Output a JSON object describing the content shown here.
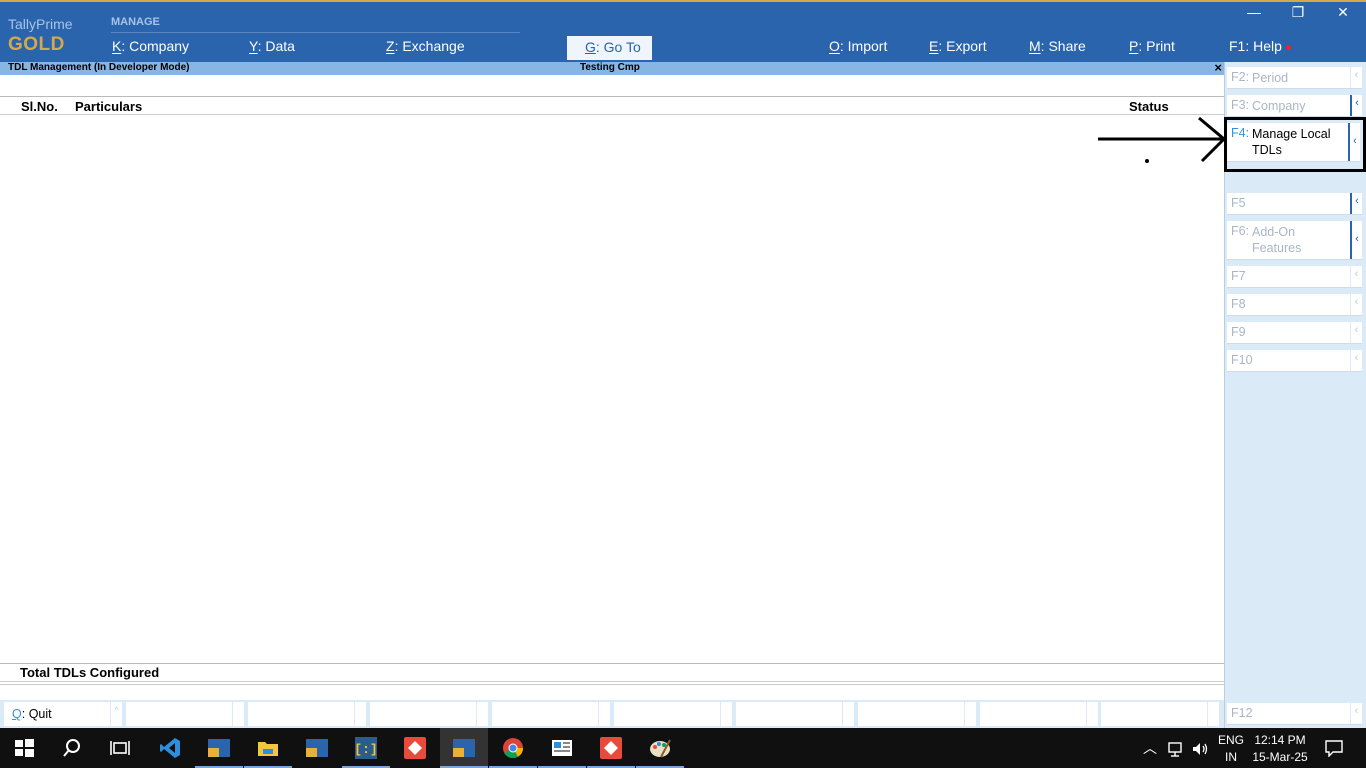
{
  "app": {
    "brand_line1": "TallyPrime",
    "brand_line2": "GOLD",
    "manage_label": "MANAGE"
  },
  "top_menu": [
    {
      "key": "K",
      "label": "Company"
    },
    {
      "key": "Y",
      "label": "Data"
    },
    {
      "key": "Z",
      "label": "Exchange"
    },
    {
      "key": "G",
      "label": "Go To"
    },
    {
      "key": "O",
      "label": "Import"
    },
    {
      "key": "E",
      "label": "Export"
    },
    {
      "key": "M",
      "label": "Share"
    },
    {
      "key": "P",
      "label": "Print"
    },
    {
      "key": "F1",
      "label": "Help"
    }
  ],
  "window_controls": {
    "minimize": "—",
    "restore": "❐",
    "close": "✕"
  },
  "info_bar": {
    "title": "TDL Management (In Developer Mode)",
    "company": "Testing Cmp",
    "close": "×"
  },
  "table": {
    "headers": [
      "Sl.No.",
      "Particulars",
      "Status"
    ],
    "rows": []
  },
  "footer": {
    "total_label": "Total TDLs Configured"
  },
  "right_panel": [
    {
      "key": "F2:",
      "label": "Period",
      "active": false
    },
    {
      "key": "F3:",
      "label": "Company",
      "active": false
    },
    {
      "key": "F4:",
      "label": "Manage Local TDLs",
      "active": true
    },
    {
      "key": "F5",
      "label": "",
      "active": false
    },
    {
      "key": "F6:",
      "label": "Add-On Features",
      "active": false
    },
    {
      "key": "F7",
      "label": "",
      "active": false
    },
    {
      "key": "F8",
      "label": "",
      "active": false
    },
    {
      "key": "F9",
      "label": "",
      "active": false
    },
    {
      "key": "F10",
      "label": "",
      "active": false
    },
    {
      "key": "F12",
      "label": "",
      "active": false
    }
  ],
  "bottom_bar": [
    {
      "key": "Q",
      "label": "Quit"
    }
  ],
  "taskbar": {
    "apps": [
      "start-icon",
      "search-icon",
      "task-view-icon",
      "vscode-icon",
      "tally-icon",
      "file-explorer-icon",
      "tally-icon",
      "brackets-icon",
      "git-icon",
      "tally-icon",
      "chrome-icon",
      "news-icon",
      "git-icon",
      "paint-icon"
    ],
    "language": "ENG",
    "region": "IN",
    "time": "12:14 PM",
    "date": "15-Mar-25"
  }
}
